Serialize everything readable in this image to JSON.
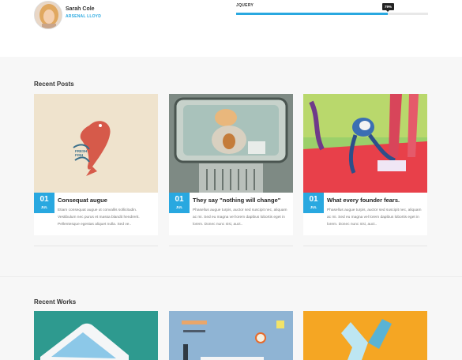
{
  "author": {
    "name": "Sarah Cole",
    "role": "ARSENAL LLOYD"
  },
  "skill": {
    "label": "JQUERY",
    "percent_label": "79%",
    "level": 0.79
  },
  "recent_posts": {
    "title": "Recent Posts",
    "posts": [
      {
        "day": "01",
        "month": "JUL",
        "title": "Consequat augue",
        "excerpt": "Etiam consequat augue ut convallis sollicitudin. Vestibulum nec purus et massa blandit hendrerit. Pellentesque egestas aliquet nulla. Sed ve..",
        "thumb_text": "FRESH FISH"
      },
      {
        "day": "01",
        "month": "JUL",
        "title": "They say \"nothing will change\"",
        "excerpt": "Phasellus augue turpis, auctor sed suscipit nec, aliquam ac mi. Sed eu magna vel lorem dapibus lobortis eget in lorem. Donec nunc nisi, auct.."
      },
      {
        "day": "01",
        "month": "JUL",
        "title": "What every founder fears.",
        "excerpt": "Phasellus augue turpis, auctor sed suscipit nec, aliquam ac mi. Sed eu magna vel lorem dapibus lobortis eget in lorem. Donec nunc nisi, auct.."
      }
    ]
  },
  "recent_works": {
    "title": "Recent Works"
  },
  "colors": {
    "accent": "#29a8e0",
    "work1": "#2e9a8f",
    "work2": "#8fb4d4",
    "work3": "#f5a623"
  }
}
